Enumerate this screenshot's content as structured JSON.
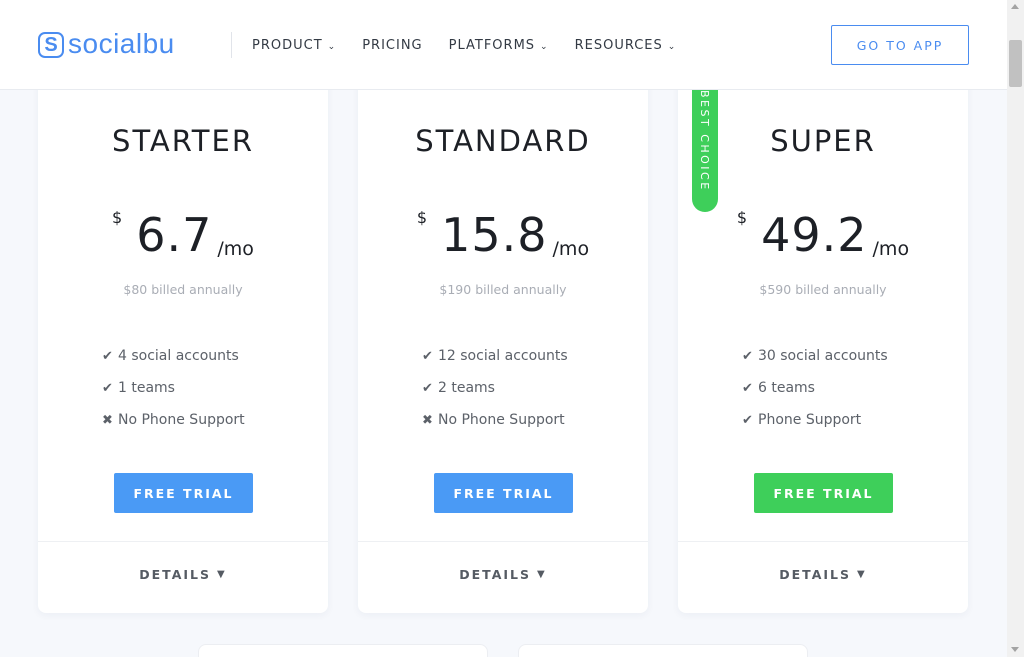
{
  "header": {
    "logo_mark": "S",
    "logo_text": "socialbu",
    "nav": [
      {
        "label": "PRODUCT",
        "dropdown": true
      },
      {
        "label": "PRICING",
        "dropdown": false
      },
      {
        "label": "PLATFORMS",
        "dropdown": true
      },
      {
        "label": "RESOURCES",
        "dropdown": true
      }
    ],
    "cta": "GO TO APP"
  },
  "ribbon": "BEST CHOICE",
  "plans": [
    {
      "name": "STARTER",
      "currency": "$",
      "price": "6.7",
      "period": "/mo",
      "billed": "$80 billed annually",
      "features": [
        {
          "icon": "check-icon",
          "glyph": "✔",
          "text": "4 social accounts"
        },
        {
          "icon": "check-icon",
          "glyph": "✔",
          "text": "1 teams"
        },
        {
          "icon": "cross-icon",
          "glyph": "✖",
          "text": "No Phone Support"
        }
      ],
      "cta": "FREE TRIAL",
      "cta_color": "#4a9af5",
      "details": "DETAILS"
    },
    {
      "name": "STANDARD",
      "currency": "$",
      "price": "15.8",
      "period": "/mo",
      "billed": "$190 billed annually",
      "features": [
        {
          "icon": "check-icon",
          "glyph": "✔",
          "text": "12 social accounts"
        },
        {
          "icon": "check-icon",
          "glyph": "✔",
          "text": "2 teams"
        },
        {
          "icon": "cross-icon",
          "glyph": "✖",
          "text": "No Phone Support"
        }
      ],
      "cta": "FREE TRIAL",
      "cta_color": "#4a9af5",
      "details": "DETAILS"
    },
    {
      "name": "SUPER",
      "currency": "$",
      "price": "49.2",
      "period": "/mo",
      "billed": "$590 billed annually",
      "features": [
        {
          "icon": "check-icon",
          "glyph": "✔",
          "text": "30 social accounts"
        },
        {
          "icon": "check-icon",
          "glyph": "✔",
          "text": "6 teams"
        },
        {
          "icon": "check-icon",
          "glyph": "✔",
          "text": "Phone Support"
        }
      ],
      "cta": "FREE TRIAL",
      "cta_color": "#3ecf5a",
      "details": "DETAILS"
    }
  ],
  "colors": {
    "brand_blue": "#4a8cf0",
    "green": "#3ecf5a",
    "background": "#f6f8fc"
  }
}
